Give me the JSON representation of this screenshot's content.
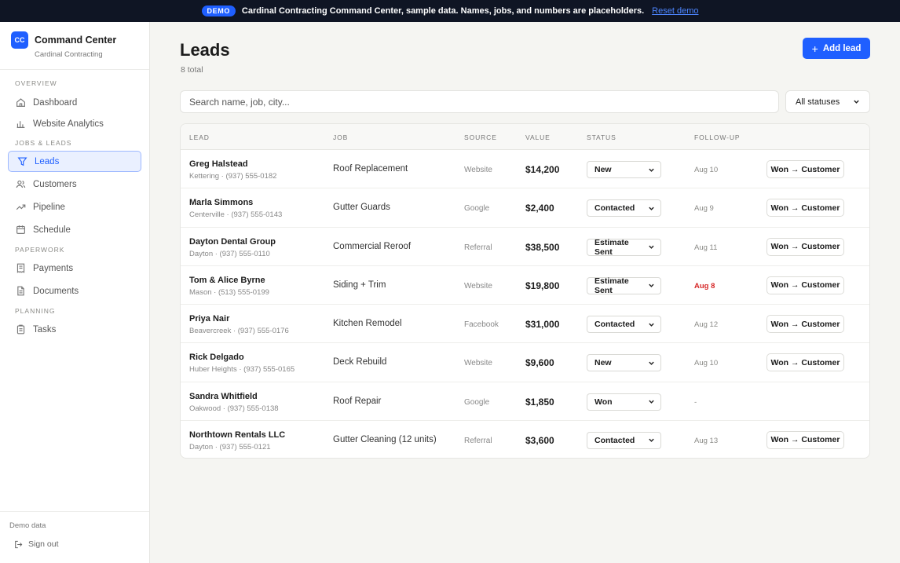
{
  "banner": {
    "pill": "DEMO",
    "message": "Cardinal Contracting Command Center, sample data. Names, jobs, and numbers are placeholders.",
    "reset_label": "Reset demo"
  },
  "brand": {
    "logo": "CC",
    "title": "Command Center",
    "subtitle": "Cardinal Contracting"
  },
  "sidebar": {
    "sections": [
      "Overview",
      "Jobs & Leads",
      "Paperwork",
      "Planning"
    ],
    "items": [
      {
        "label": "Dashboard",
        "icon": "home-icon"
      },
      {
        "label": "Website Analytics",
        "icon": "bar-chart-icon"
      },
      {
        "label": "Leads",
        "icon": "funnel-icon",
        "active": true
      },
      {
        "label": "Customers",
        "icon": "users-icon"
      },
      {
        "label": "Pipeline",
        "icon": "trend-icon"
      },
      {
        "label": "Schedule",
        "icon": "calendar-icon"
      },
      {
        "label": "Payments",
        "icon": "receipt-icon"
      },
      {
        "label": "Documents",
        "icon": "document-icon"
      },
      {
        "label": "Tasks",
        "icon": "clipboard-icon"
      }
    ],
    "footer": {
      "demo_label": "Demo data",
      "signout_label": "Sign out"
    }
  },
  "main": {
    "title": "Leads",
    "count": "8 total",
    "add_label": "Add lead",
    "search_placeholder": "Search name, job, city...",
    "status_filter": "All statuses"
  },
  "table": {
    "columns": [
      "Lead",
      "Job",
      "Source",
      "Value",
      "Status",
      "Follow-up"
    ],
    "convert_label": "Won → Customer",
    "rows": [
      {
        "name": "Greg Halstead",
        "sub": "Kettering · (937) 555-0182",
        "job": "Roof Replacement",
        "source": "Website",
        "value": "$14,200",
        "status": "New",
        "followup": "Aug 10",
        "overdue": false,
        "convert": true
      },
      {
        "name": "Marla Simmons",
        "sub": "Centerville · (937) 555-0143",
        "job": "Gutter Guards",
        "source": "Google",
        "value": "$2,400",
        "status": "Contacted",
        "followup": "Aug 9",
        "overdue": false,
        "convert": true
      },
      {
        "name": "Dayton Dental Group",
        "sub": "Dayton · (937) 555-0110",
        "job": "Commercial Reroof",
        "source": "Referral",
        "value": "$38,500",
        "status": "Estimate Sent",
        "followup": "Aug 11",
        "overdue": false,
        "convert": true
      },
      {
        "name": "Tom & Alice Byrne",
        "sub": "Mason · (513) 555-0199",
        "job": "Siding + Trim",
        "source": "Website",
        "value": "$19,800",
        "status": "Estimate Sent",
        "followup": "Aug 8",
        "overdue": true,
        "convert": true
      },
      {
        "name": "Priya Nair",
        "sub": "Beavercreek · (937) 555-0176",
        "job": "Kitchen Remodel",
        "source": "Facebook",
        "value": "$31,000",
        "status": "Contacted",
        "followup": "Aug 12",
        "overdue": false,
        "convert": true
      },
      {
        "name": "Rick Delgado",
        "sub": "Huber Heights · (937) 555-0165",
        "job": "Deck Rebuild",
        "source": "Website",
        "value": "$9,600",
        "status": "New",
        "followup": "Aug 10",
        "overdue": false,
        "convert": true
      },
      {
        "name": "Sandra Whitfield",
        "sub": "Oakwood · (937) 555-0138",
        "job": "Roof Repair",
        "source": "Google",
        "value": "$1,850",
        "status": "Won",
        "followup": "-",
        "overdue": false,
        "convert": false
      },
      {
        "name": "Northtown Rentals LLC",
        "sub": "Dayton · (937) 555-0121",
        "job": "Gutter Cleaning (12 units)",
        "source": "Referral",
        "value": "$3,600",
        "status": "Contacted",
        "followup": "Aug 13",
        "overdue": false,
        "convert": true
      }
    ]
  },
  "colors": {
    "accent": "#1f5fff",
    "overdue": "#d62828",
    "banner_bg": "#0f1524"
  }
}
